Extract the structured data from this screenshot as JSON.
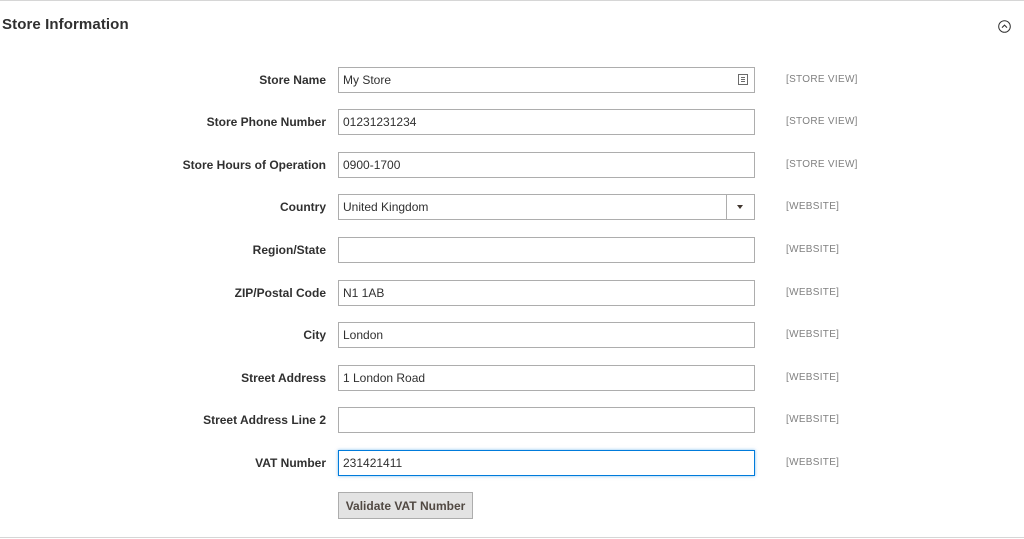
{
  "section": {
    "title": "Store Information",
    "collapse_icon": "chevron-up-circle-icon"
  },
  "fields": [
    {
      "label": "Store Name",
      "value": "My Store",
      "scope": "[STORE VIEW]",
      "type": "text"
    },
    {
      "label": "Store Phone Number",
      "value": "01231231234",
      "scope": "[STORE VIEW]",
      "type": "text"
    },
    {
      "label": "Store Hours of Operation",
      "value": "0900-1700",
      "scope": "[STORE VIEW]",
      "type": "text"
    },
    {
      "label": "Country",
      "value": "United Kingdom",
      "scope": "[WEBSITE]",
      "type": "select"
    },
    {
      "label": "Region/State",
      "value": "",
      "scope": "[WEBSITE]",
      "type": "text"
    },
    {
      "label": "ZIP/Postal Code",
      "value": "N1 1AB",
      "scope": "[WEBSITE]",
      "type": "text"
    },
    {
      "label": "City",
      "value": "London",
      "scope": "[WEBSITE]",
      "type": "text"
    },
    {
      "label": "Street Address",
      "value": "1 London Road",
      "scope": "[WEBSITE]",
      "type": "text"
    },
    {
      "label": "Street Address Line 2",
      "value": "",
      "scope": "[WEBSITE]",
      "type": "text"
    },
    {
      "label": "VAT Number",
      "value": "231421411",
      "scope": "[WEBSITE]",
      "type": "text",
      "focused": true
    }
  ],
  "validate_button": {
    "label": "Validate VAT Number"
  },
  "colors": {
    "focus_border": "#007bdb",
    "input_border": "#adadad",
    "button_bg": "#e3e3e3",
    "scope_text": "#808080"
  }
}
